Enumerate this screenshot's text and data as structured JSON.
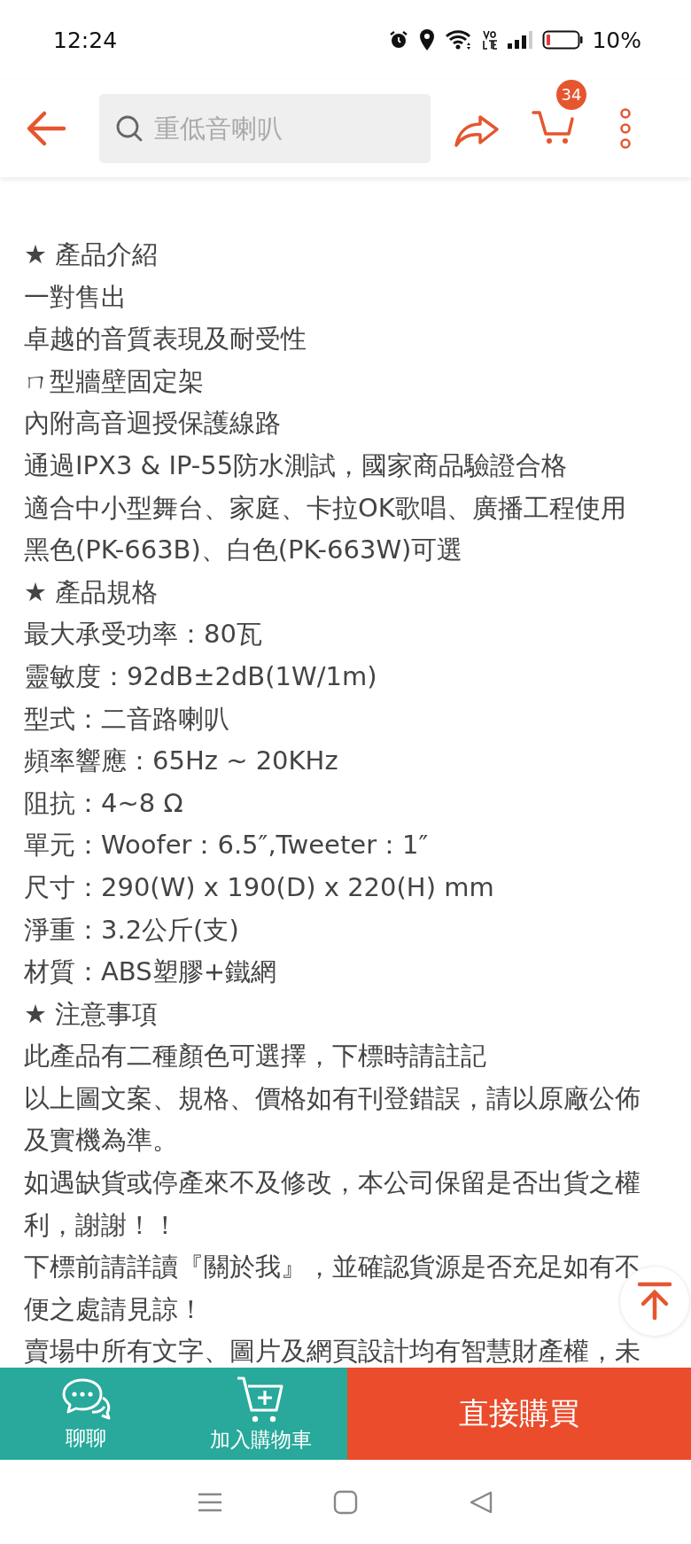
{
  "status_bar": {
    "time": "12:24",
    "battery": "10%"
  },
  "header": {
    "search": {
      "placeholder": "重低音喇叭"
    },
    "cart_count": "34"
  },
  "description": [
    "★ 產品介紹",
    "一對售出",
    "卓越的音質表現及耐受性",
    "ㄇ型牆壁固定架",
    "內附高音迴授保護線路",
    "通過IPX3 & IP-55防水測試，國家商品驗證合格",
    "適合中小型舞台、家庭、卡拉OK歌唱、廣播工程使用",
    "黑色(PK-663B)、白色(PK-663W)可選",
    "★ 產品規格",
    "最大承受功率：80瓦",
    "靈敏度：92dB±2dB(1W/1m)",
    "型式：二音路喇叭",
    "頻率響應：65Hz ~ 20KHz",
    "阻抗：4~8 Ω",
    "單元：Woofer：6.5″,Tweeter：1″",
    "尺寸：290(W) x 190(D) x 220(H) mm",
    "淨重：3.2公斤(支)",
    "材質：ABS塑膠+鐵網",
    "★ 注意事項",
    "此產品有二種顏色可選擇，下標時請註記",
    "以上圖文案、規格、價格如有刊登錯誤，請以原廠公佈及實機為準。",
    "如遇缺貨或停產來不及修改，本公司保留是否出貨之權利，謝謝！！",
    "下標前請詳讀『關於我』，並確認貨源是否充足如有不便之處請見諒！",
    "賣場中所有文字、圖片及網頁設計均有智慧財產權，未"
  ],
  "bottom_bar": {
    "chat_label": "聊聊",
    "add_to_cart_label": "加入購物車",
    "buy_label": "直接購買"
  }
}
